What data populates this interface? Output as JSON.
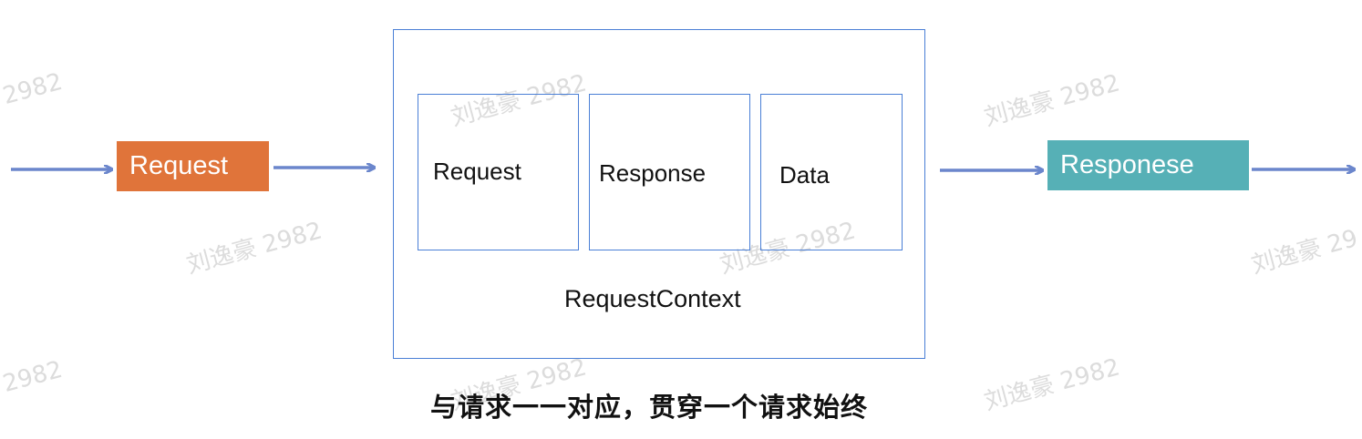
{
  "watermark": {
    "text": "刘逸豪 2982",
    "number": "2982",
    "partial_right": "刘逸豪 29"
  },
  "input": {
    "label": "Request",
    "color": "#e0743a"
  },
  "context": {
    "caption": "RequestContext",
    "items": [
      "Request",
      "Response",
      "Data"
    ]
  },
  "output": {
    "label": "Responese",
    "color": "#56b0b6"
  },
  "note": "与请求一一对应，贯穿一个请求始终",
  "colors": {
    "arrow": "#6b86cc",
    "box_border": "#4a7fd6"
  }
}
